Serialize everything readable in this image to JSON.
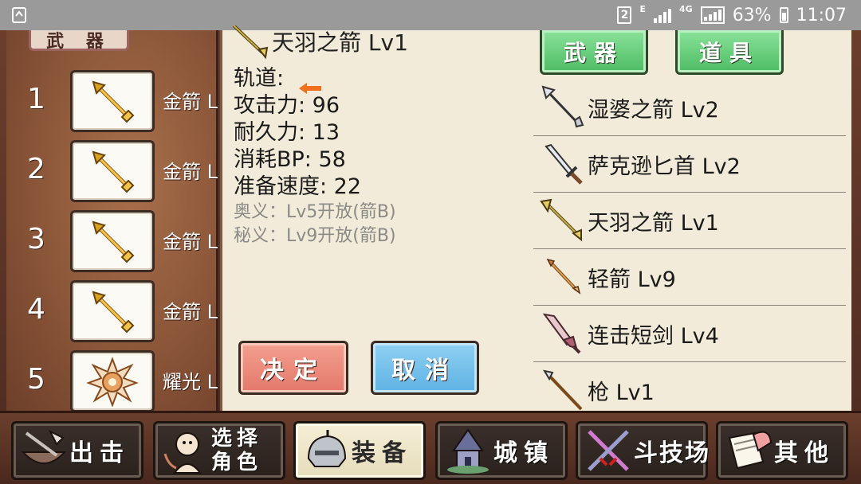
{
  "status_bar": {
    "sim_label": "2",
    "network_small": "E",
    "network_4g": "4G",
    "battery_percent": "63%",
    "time": "11:07"
  },
  "left_panel": {
    "tab_label": "武 器",
    "slots": [
      {
        "num": "1",
        "name": "金箭 L",
        "icon": "gold-arrow-icon"
      },
      {
        "num": "2",
        "name": "金箭 L",
        "icon": "gold-arrow-icon"
      },
      {
        "num": "3",
        "name": "金箭 L",
        "icon": "gold-arrow-icon"
      },
      {
        "num": "4",
        "name": "金箭 L",
        "icon": "gold-arrow-icon"
      },
      {
        "num": "5",
        "name": "耀光 L",
        "icon": "radiance-icon"
      }
    ]
  },
  "detail": {
    "title": "天羽之箭 Lv1",
    "track_label": "轨道:",
    "attack": "攻击力: 96",
    "durability": "耐久力: 13",
    "bp_cost": "消耗BP: 58",
    "prep_speed": "准备速度: 22",
    "secret1": "奥义：Lv5开放(箭B)",
    "secret2": "秘义：Lv9开放(箭B)",
    "decide_label": "决定",
    "cancel_label": "取消",
    "tab_weapon": "武器",
    "tab_item": "道具"
  },
  "items": [
    {
      "name": "湿婆之箭 Lv2",
      "icon": "shiva-arrow-icon"
    },
    {
      "name": "萨克逊匕首 Lv2",
      "icon": "saxon-dagger-icon"
    },
    {
      "name": "天羽之箭 Lv1",
      "icon": "feather-arrow-icon"
    },
    {
      "name": "轻箭 Lv9",
      "icon": "light-arrow-icon"
    },
    {
      "name": "连击短剑 Lv4",
      "icon": "combo-shortsword-icon"
    },
    {
      "name": "枪 Lv1",
      "icon": "spear-icon"
    }
  ],
  "bottom_nav": [
    {
      "label": "出击",
      "icon": "sortie-icon"
    },
    {
      "label_1": "选择",
      "label_2": "角色",
      "icon": "character-icon"
    },
    {
      "label": "装备",
      "icon": "equipment-icon",
      "active": true
    },
    {
      "label": "城镇",
      "icon": "town-icon"
    },
    {
      "label": "斗技场",
      "icon": "arena-icon"
    },
    {
      "label": "其他",
      "icon": "other-icon"
    }
  ],
  "colors": {
    "decide_button": "#e2786a",
    "cancel_button": "#5eb2e4",
    "tab_button": "#4dbb63",
    "track_arrow": "#f07020"
  }
}
